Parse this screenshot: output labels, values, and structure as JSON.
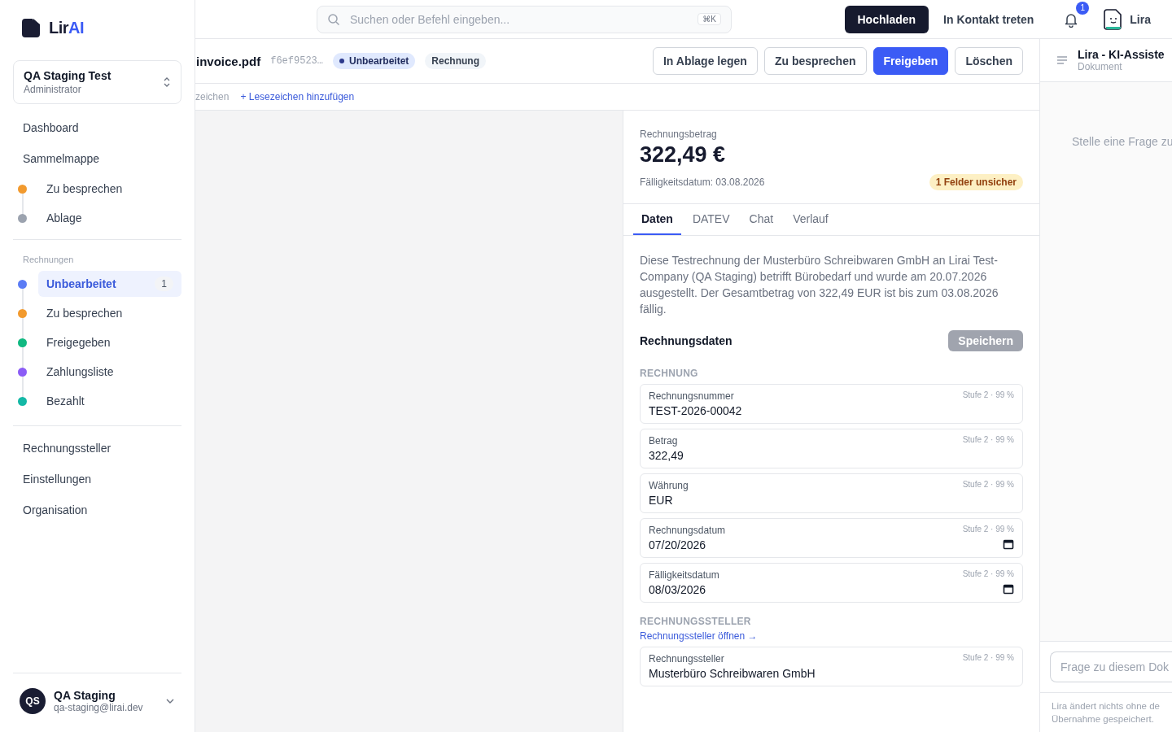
{
  "sidebar": {
    "logo": {
      "main": "Lir",
      "accent": "AI"
    },
    "workspace": {
      "name": "QA Staging Test",
      "role": "Administrator"
    },
    "nav_top": [
      {
        "label": "Dashboard",
        "selected": false
      },
      {
        "label": "Sammelmappe",
        "selected": false
      }
    ],
    "sammelmappe_items": [
      {
        "label": "Zu besprechen",
        "color": "#f29a2e",
        "selected": false
      },
      {
        "label": "Ablage",
        "color": "#9ca3af",
        "selected": false
      }
    ],
    "section_title": "Rechnungen",
    "invoice_items": [
      {
        "label": "Unbearbeitet",
        "color": "#5b7cf5",
        "selected": true,
        "count": "1"
      },
      {
        "label": "Zu besprechen",
        "color": "#f29a2e",
        "selected": false
      },
      {
        "label": "Freigegeben",
        "color": "#10b981",
        "selected": false
      },
      {
        "label": "Zahlungsliste",
        "color": "#8b5cf6",
        "selected": false
      },
      {
        "label": "Bezahlt",
        "color": "#14b8a6",
        "selected": false
      }
    ],
    "nav_bottom": [
      {
        "label": "Rechnungssteller",
        "selected": false
      },
      {
        "label": "Einstellungen",
        "selected": false
      },
      {
        "label": "Organisation",
        "selected": false
      }
    ],
    "user": {
      "initials": "QS",
      "name": "QA Staging",
      "email": "qa-staging@lirai.dev"
    }
  },
  "topbar": {
    "search_placeholder": "Suchen oder Befehl eingeben...",
    "shortcut": "⌘K",
    "upload_button": "Hochladen",
    "contact_link": "In Kontakt treten",
    "notification_count": "1",
    "assistant_name": "Lira"
  },
  "document": {
    "filename": "invoice.pdf",
    "hash": "f6ef9523…",
    "status_badge": "Unbearbeitet",
    "type_badge": "Rechnung",
    "actions": [
      {
        "label": "In Ablage legen",
        "kind": "outline"
      },
      {
        "label": "Zu besprechen",
        "kind": "outline"
      },
      {
        "label": "Freigeben",
        "kind": "primary"
      },
      {
        "label": "Löschen",
        "kind": "outline"
      }
    ],
    "bookmarks_label": "zeichen",
    "add_bookmark": "+ Lesezeichen hinzufügen"
  },
  "summary": {
    "amount_label": "Rechnungsbetrag",
    "amount": "322,49 €",
    "due_text": "Fälligkeitsdatum: 03.08.2026",
    "warning_badge": "1 Felder unsicher"
  },
  "tabs": [
    {
      "label": "Daten",
      "selected": true
    },
    {
      "label": "DATEV",
      "selected": false
    },
    {
      "label": "Chat",
      "selected": false
    },
    {
      "label": "Verlauf",
      "selected": false
    }
  ],
  "description": "Diese Testrechnung der Musterbüro Schreibwaren GmbH an Lirai Test-Company (QA Staging) betrifft Bürobedarf und wurde am 20.07.2026 ausgestellt. Der Gesamtbetrag von 322,49 EUR ist bis zum 03.08.2026 fällig.",
  "data_section": {
    "title": "Rechnungsdaten",
    "save_button": "Speichern",
    "save_disabled": true,
    "groups": [
      {
        "title": "RECHNUNG",
        "fields": [
          {
            "label": "Rechnungsnummer",
            "value": "TEST-2026-00042",
            "confidence": "Stufe 2 · 99 %",
            "kind": "text"
          },
          {
            "label": "Betrag",
            "value": "322,49",
            "confidence": "Stufe 2 · 99 %",
            "kind": "text"
          },
          {
            "label": "Währung",
            "value": "EUR",
            "confidence": "Stufe 2 · 99 %",
            "kind": "text"
          },
          {
            "label": "Rechnungsdatum",
            "value": "07/20/2026",
            "confidence": "Stufe 2 · 99 %",
            "kind": "date"
          },
          {
            "label": "Fälligkeitsdatum",
            "value": "08/03/2026",
            "confidence": "Stufe 2 · 99 %",
            "kind": "date"
          }
        ]
      },
      {
        "title": "RECHNUNGSSTELLER",
        "link": "Rechnungssteller öffnen →",
        "fields": [
          {
            "label": "Rechnungssteller",
            "value": "Musterbüro Schreibwaren GmbH",
            "confidence": "Stufe 2 · 99 %",
            "kind": "text"
          }
        ]
      }
    ]
  },
  "assistant": {
    "title": "Lira - KI-Assiste",
    "subtitle": "Dokument",
    "empty_text": "Stelle eine Frage zu",
    "input_placeholder": "Frage zu diesem Dok",
    "footer_lines": [
      "Lira ändert nichts ohne de",
      "Übernahme gespeichert."
    ]
  }
}
